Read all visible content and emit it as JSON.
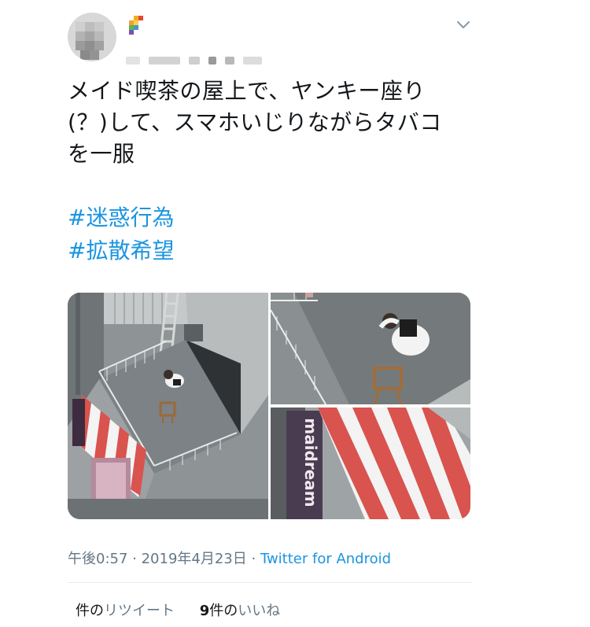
{
  "tweet": {
    "text_lines": [
      "メイド喫茶の屋上で、ヤンキー座り",
      "(？)して、スマホいじりながらタバコ",
      "を一服"
    ],
    "hashtags": [
      "#迷惑行為",
      "#拡散希望"
    ],
    "timestamp": "午後0:57 · 2019年4月23日",
    "separator": " · ",
    "source": "Twitter for Android"
  },
  "stats": {
    "retweets_label": "件の",
    "retweets_label2": "リツイート",
    "likes_count": "9",
    "likes_label": "件の",
    "likes_label2": "いいね"
  },
  "images": {
    "main_sign_text": "",
    "closeup_sign_text": "maidream"
  },
  "colors": {
    "text": "#14171a",
    "link": "#1b95e0",
    "muted": "#657786",
    "divider": "#e6ecf0",
    "awning_red": "#d9534f"
  }
}
